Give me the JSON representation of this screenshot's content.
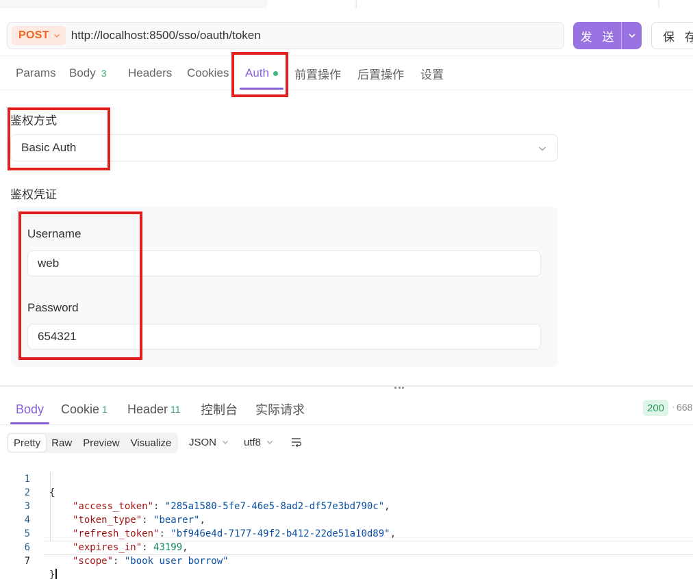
{
  "request": {
    "method": "POST",
    "url": "http://localhost:8500/sso/oauth/token",
    "send_label": "发 送",
    "save_label": "保 存"
  },
  "request_tabs": [
    {
      "label": "Params"
    },
    {
      "label": "Body",
      "badge": "3"
    },
    {
      "label": "Headers"
    },
    {
      "label": "Cookies"
    },
    {
      "label": "Auth",
      "active": true
    },
    {
      "label": "前置操作"
    },
    {
      "label": "后置操作"
    },
    {
      "label": "设置"
    }
  ],
  "auth": {
    "type_label": "鉴权方式",
    "type_value": "Basic Auth",
    "credentials_label": "鉴权凭证",
    "username_label": "Username",
    "username_value": "web",
    "password_label": "Password",
    "password_value": "654321"
  },
  "response_tabs": [
    {
      "label": "Body",
      "active": true
    },
    {
      "label": "Cookie",
      "badge": "1"
    },
    {
      "label": "Header",
      "badge": "11"
    },
    {
      "label": "控制台"
    },
    {
      "label": "实际请求"
    }
  ],
  "response_meta": {
    "status": "200",
    "size": "668"
  },
  "view_modes": [
    "Pretty",
    "Raw",
    "Preview",
    "Visualize"
  ],
  "active_view": "Pretty",
  "format": "JSON",
  "encoding": "utf8",
  "body_lines": [
    {
      "n": "1",
      "open": "{"
    },
    {
      "n": "2",
      "key": "\"access_token\"",
      "value": "\"285a1580-5fe7-46e5-8ad2-df57e3bd790c\"",
      "type": "string",
      "comma": ","
    },
    {
      "n": "3",
      "key": "\"token_type\"",
      "value": "\"bearer\"",
      "type": "string",
      "comma": ","
    },
    {
      "n": "4",
      "key": "\"refresh_token\"",
      "value": "\"bf946e4d-7177-49f2-b412-22de51a10d89\"",
      "type": "string",
      "comma": ","
    },
    {
      "n": "5",
      "key": "\"expires_in\"",
      "value": "43199",
      "type": "number",
      "comma": ","
    },
    {
      "n": "6",
      "key": "\"scope\"",
      "value": "\"book user borrow\"",
      "type": "string",
      "comma": ""
    },
    {
      "n": "7",
      "close": "}"
    }
  ],
  "colors": {
    "accent": "#8a5fdc",
    "send_button": "#9a73e3",
    "method": "#f0651f",
    "highlight_box": "#e0201f",
    "status_ok": "#2e9b5e"
  }
}
